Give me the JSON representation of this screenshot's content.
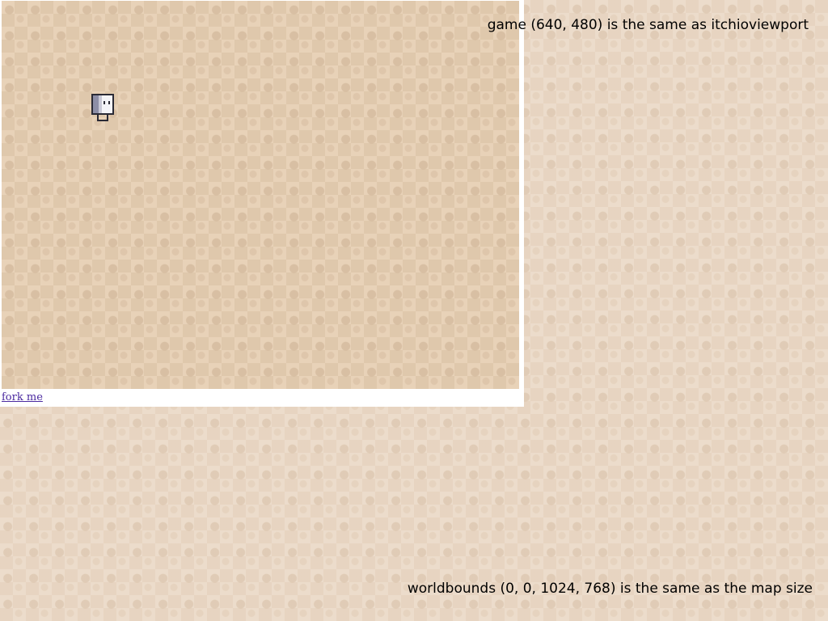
{
  "game": {
    "link_text": "fork me",
    "sprite": "player-sprite"
  },
  "overlay": {
    "viewport_caption": "game (640, 480) is the same as itchioviewport",
    "world_caption": "worldbounds (0, 0, 1024, 768) is the same as the map size"
  }
}
